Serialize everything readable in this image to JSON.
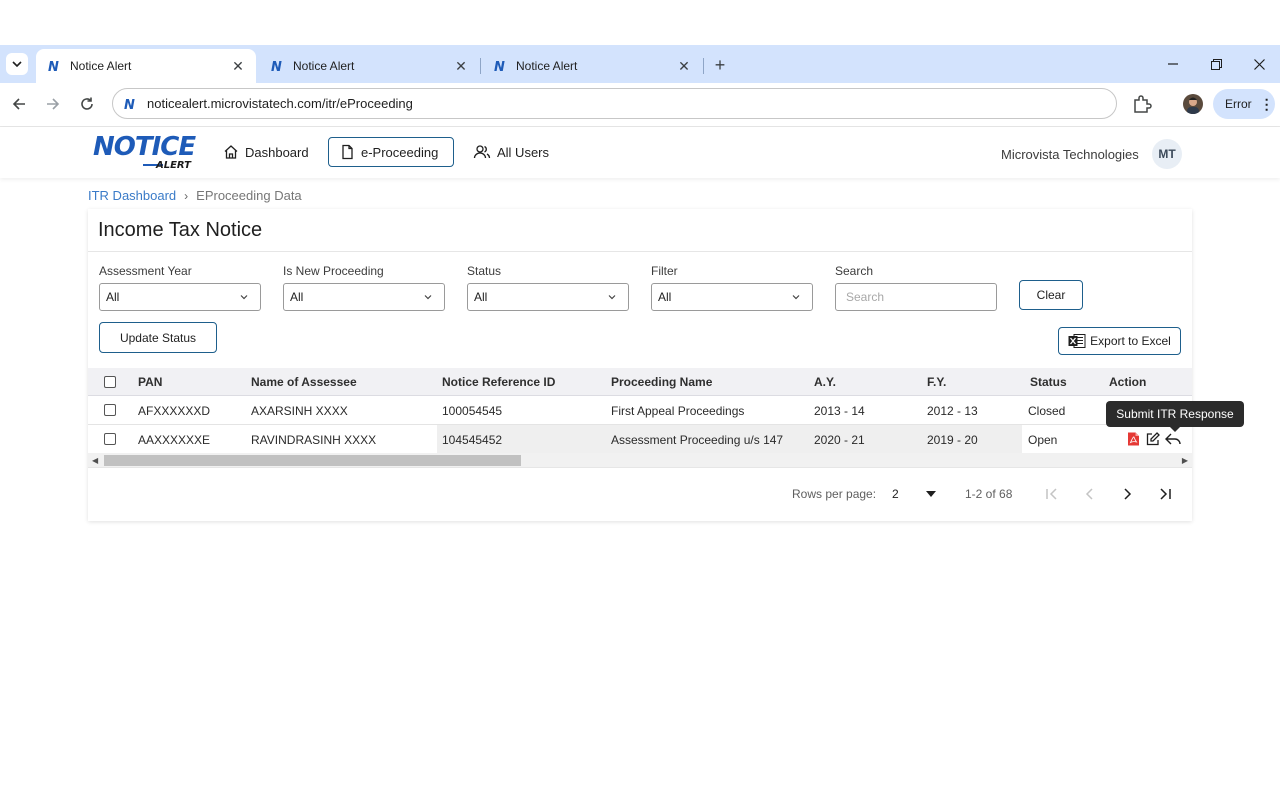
{
  "browser": {
    "tabs": [
      {
        "title": "Notice Alert",
        "active": true
      },
      {
        "title": "Notice Alert",
        "active": false
      },
      {
        "title": "Notice Alert",
        "active": false
      }
    ],
    "url": "noticealert.microvistatech.com/itr/eProceeding",
    "error_label": "Error"
  },
  "header": {
    "logo_main": "NOTICE",
    "logo_sub": "ALERT",
    "nav": [
      {
        "label": "Dashboard",
        "icon": "home-icon"
      },
      {
        "label": "e-Proceeding",
        "icon": "document-icon",
        "active": true
      },
      {
        "label": "All Users",
        "icon": "users-icon"
      }
    ],
    "company": "Microvista Technologies",
    "user_initials": "MT"
  },
  "breadcrumb": {
    "link": "ITR Dashboard",
    "current": "EProceeding Data"
  },
  "card": {
    "title": "Income Tax Notice",
    "filters": {
      "assessment_year": {
        "label": "Assessment Year",
        "value": "All"
      },
      "is_new_proceeding": {
        "label": "Is New Proceeding",
        "value": "All"
      },
      "status": {
        "label": "Status",
        "value": "All"
      },
      "filter": {
        "label": "Filter",
        "value": "All"
      },
      "search": {
        "label": "Search",
        "placeholder": "Search"
      }
    },
    "clear_label": "Clear",
    "update_status_label": "Update Status",
    "export_label": "Export to Excel"
  },
  "table": {
    "columns": [
      "PAN",
      "Name of Assessee",
      "Notice Reference ID",
      "Proceeding Name",
      "A.Y.",
      "F.Y.",
      "Status",
      "Action"
    ],
    "rows": [
      {
        "pan": "AFXXXXXXD",
        "name": "AXARSINH XXXX",
        "ref_id": "100054545",
        "proceeding": "First Appeal Proceedings",
        "ay": "2013 - 14",
        "fy": "2012 - 13",
        "status": "Closed"
      },
      {
        "pan": "AAXXXXXXE",
        "name": "RAVINDRASINH XXXX",
        "ref_id": "104545452",
        "proceeding": "Assessment Proceeding u/s 147",
        "ay": "2020 - 21",
        "fy": "2019 - 20",
        "status": "Open"
      }
    ]
  },
  "pagination": {
    "rows_per_page_label": "Rows per page:",
    "rows_per_page": "2",
    "range": "1-2 of 68"
  },
  "tooltip": "Submit ITR Response",
  "colors": {
    "brand": "#1e5bb8",
    "accent_border": "#1e5f8c",
    "chrome_tabstrip": "#d3e3fd",
    "pdf_red": "#e53935"
  }
}
